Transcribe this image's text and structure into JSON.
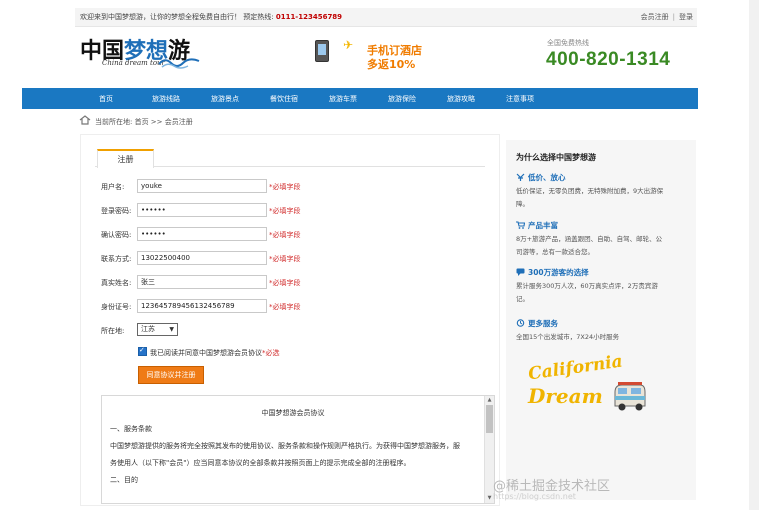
{
  "topbar": {
    "welcome": "欢迎来到中国梦想游，让你的梦想全程免费自由行！",
    "hotline_label": "预定热线:",
    "hotline_number": "0111-123456789",
    "register_link": "会员注册",
    "login_link": "登录"
  },
  "header": {
    "logo_text_1": "中国",
    "logo_text_2": "梦想",
    "logo_text_3": "游",
    "logo_sub": "China dream tour",
    "promo_line1": "手机订酒店",
    "promo_line2": "多返10%",
    "free_line_label": "全国免费热线",
    "free_line_number": "400-820-1314"
  },
  "nav": {
    "items": [
      "首页",
      "旅游线路",
      "旅游景点",
      "餐饮住宿",
      "旅游车票",
      "旅游保险",
      "旅游攻略",
      "注意事项"
    ]
  },
  "breadcrumb": {
    "text": "当前所在地: 首页 >> 会员注册"
  },
  "form": {
    "tab_label": "注册",
    "required_text": "*必填字段",
    "fields": [
      {
        "label": "用户名:",
        "value": "youke"
      },
      {
        "label": "登录密码:",
        "value": "••••••"
      },
      {
        "label": "确认密码:",
        "value": "••••••"
      },
      {
        "label": "联系方式:",
        "value": "13022500400"
      },
      {
        "label": "真实姓名:",
        "value": "张三"
      },
      {
        "label": "身份证号:",
        "value": "123645789456132456789"
      }
    ],
    "location_label": "所在地:",
    "location_value": "江苏",
    "agree_text": "我已阅读并同意中国梦想游会员协议",
    "agree_required": "*必选",
    "submit_label": "同意协议并注册"
  },
  "agreement": {
    "title": "中国梦想游会员协议",
    "lines": [
      "一、服务条款",
      "中国梦想游提供的服务将完全按照其发布的使用协议、服务条款和操作规则严格执行。为获得中国梦想游服务，服",
      "务使用人（以下称\"会员\"）应当同意本协议的全部条款并按照页面上的提示完成全部的注册程序。",
      "二、目的"
    ]
  },
  "sidebar": {
    "title": "为什么选择中国梦想游",
    "sections": [
      {
        "head": "低价、放心",
        "text": "低价保证，无零负团费，无特殊附加费，9大出游保障。",
        "icon": "yen-icon"
      },
      {
        "head": "产品丰富",
        "text": "8万+旅游产品，涵盖跟团、自助、自驾、邮轮、公司游等，总有一款适合您。",
        "icon": "cart-icon"
      },
      {
        "head": "300万游客的选择",
        "text": "累计服务300万人次，60万真实点评，2万贵宾游记。",
        "icon": "chat-icon"
      },
      {
        "head": "更多服务",
        "text": "全国15个出发城市，7X24小时服务",
        "icon": "service-icon"
      }
    ],
    "dream_line1": "California",
    "dream_line2": "Dream"
  },
  "watermark": {
    "main": "@稀土掘金技术社区",
    "sub": "https://blog.csdn.net"
  },
  "colors": {
    "nav_blue": "#1a78c2",
    "brand_orange": "#ef7b16",
    "hotline_red": "#c00000",
    "free_green": "#3a8a24",
    "required_red": "#d12b2b",
    "side_blue": "#1f6fb8"
  }
}
